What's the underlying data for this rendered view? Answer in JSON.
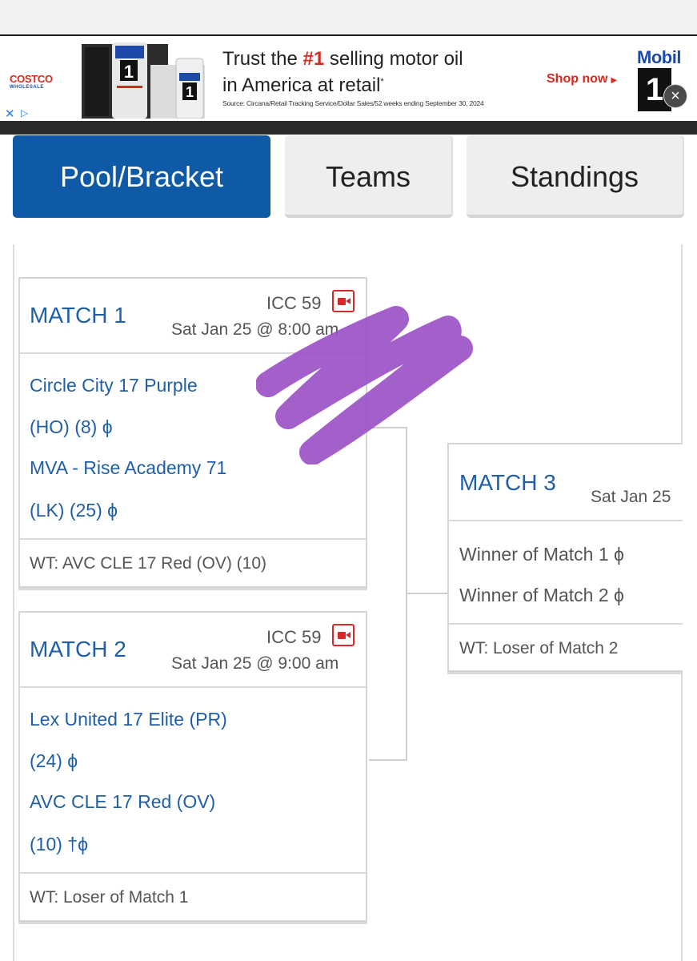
{
  "ad": {
    "advertiser": "COSTCO",
    "advertiser_sub": "WHOLESALE",
    "product_brand": "Mobil",
    "product_mark": "1",
    "headline_pre": "Trust the ",
    "headline_num": "#1",
    "headline_post": " selling motor oil",
    "headline_line2": "in America at retail",
    "headline_mark": "*",
    "source": "Source: Circana/Retail Tracking Service/Dollar Sales/52 weeks ending September 30, 2024",
    "cta": "Shop now",
    "brand_logo_text": "Mobil",
    "brand_logo_mark": "1",
    "close_label": "×",
    "adchoices_x": "✕",
    "adchoices_icon": "▷"
  },
  "tabs": [
    {
      "label": "Pool/Bracket",
      "active": true
    },
    {
      "label": "Teams",
      "active": false
    },
    {
      "label": "Standings",
      "active": false
    }
  ],
  "matches": {
    "m1": {
      "title": "MATCH 1",
      "court": "ICC 59",
      "time": "Sat Jan 25 @ 8:00 am",
      "team1_line1": "Circle City 17 Purple",
      "team1_line2": "(HO) (8) ϕ",
      "team2_line1": "MVA - Rise Academy 71",
      "team2_line2": "(LK) (25) ϕ",
      "work_team": "WT: AVC CLE 17 Red (OV) (10)"
    },
    "m2": {
      "title": "MATCH 2",
      "court": "ICC 59",
      "time": "Sat Jan 25 @ 9:00 am",
      "team1_line1": "Lex United 17 Elite (PR)",
      "team1_line2": "(24) ϕ",
      "team2_line1": "AVC CLE 17 Red (OV)",
      "team2_line2": "(10) †ϕ",
      "work_team": "WT: Loser of Match 1"
    },
    "m3": {
      "title": "MATCH 3",
      "time": "Sat Jan 25",
      "team1": "Winner of Match 1 ϕ",
      "team2": "Winner of Match 2 ϕ",
      "work_team": "WT: Loser of Match 2"
    }
  },
  "colors": {
    "accent_blue": "#0e5aa7",
    "link_blue": "#1f5fa8",
    "video_red": "#d42a2a",
    "redaction_purple": "#9a4fc4"
  },
  "icons": {
    "video": "video-camera-icon",
    "close": "close-icon",
    "adchoices": "adchoices-icon"
  }
}
